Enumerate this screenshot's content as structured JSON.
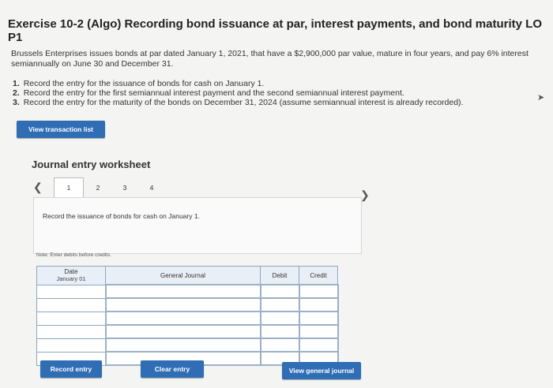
{
  "exercise": {
    "title": "Exercise 10-2 (Algo) Recording bond issuance at par, interest payments, and bond maturity LO P1",
    "intro": "Brussels Enterprises issues bonds at par dated January 1, 2021, that have a $2,900,000 par value, mature in four years, and pay 6% interest semiannually on June 30 and December 31.",
    "steps": [
      {
        "num": "1.",
        "text": "Record the entry for the issuance of bonds for cash on January 1."
      },
      {
        "num": "2.",
        "text": "Record the entry for the first semiannual interest payment and the second semiannual interest payment."
      },
      {
        "num": "3.",
        "text": "Record the entry for the maturity of the bonds on December 31, 2024 (assume semiannual interest is already recorded)."
      }
    ]
  },
  "buttons": {
    "view_transaction_list": "View transaction list",
    "record_entry": "Record entry",
    "clear_entry": "Clear entry",
    "view_general_journal": "View general journal"
  },
  "worksheet": {
    "title": "Journal entry worksheet",
    "tabs": [
      "1",
      "2",
      "3",
      "4"
    ],
    "active_tab": "1",
    "instruction": "Record the issuance of bonds for cash on January 1.",
    "note": "Note: Enter debits before credits.",
    "columns": {
      "date": "Date",
      "general_journal": "General Journal",
      "debit": "Debit",
      "credit": "Credit"
    },
    "first_date": "January 01"
  },
  "colors": {
    "button_blue": "#2f6db5",
    "grid_border": "#8ca6c0"
  }
}
